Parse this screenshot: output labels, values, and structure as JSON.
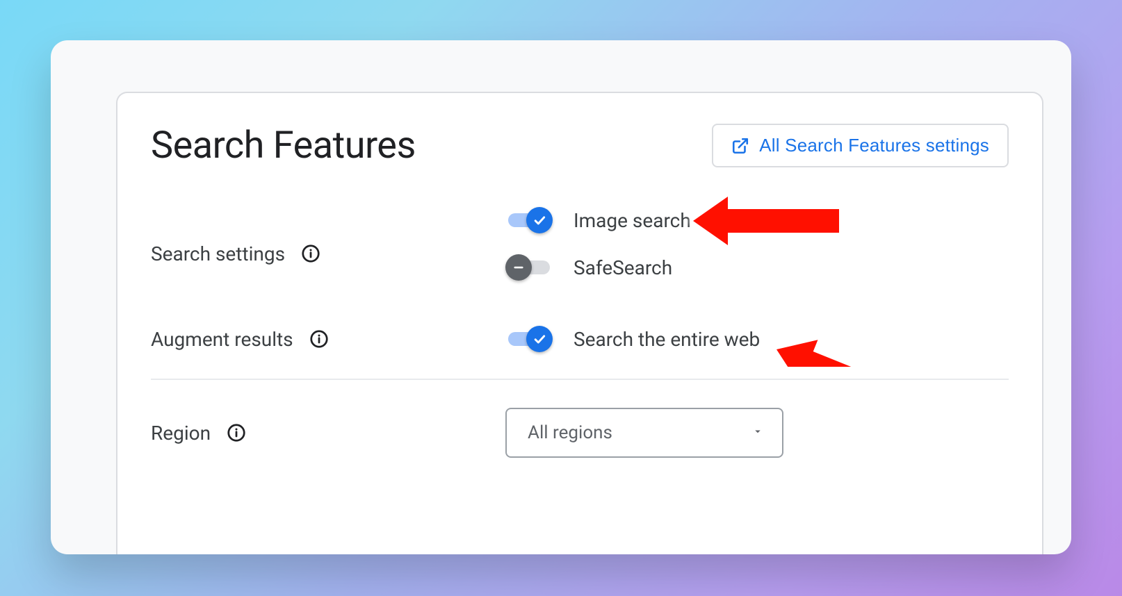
{
  "header": {
    "title": "Search Features",
    "all_settings_link": "All Search Features settings"
  },
  "sections": {
    "search_settings": {
      "label": "Search settings",
      "toggles": {
        "image_search": {
          "label": "Image search",
          "state": "on"
        },
        "safesearch": {
          "label": "SafeSearch",
          "state": "off"
        }
      }
    },
    "augment_results": {
      "label": "Augment results",
      "toggles": {
        "entire_web": {
          "label": "Search the entire web",
          "state": "on"
        }
      }
    },
    "region": {
      "label": "Region",
      "selected": "All regions"
    }
  },
  "annotations": {
    "arrow1_target": "image_search",
    "arrow2_target": "entire_web"
  }
}
